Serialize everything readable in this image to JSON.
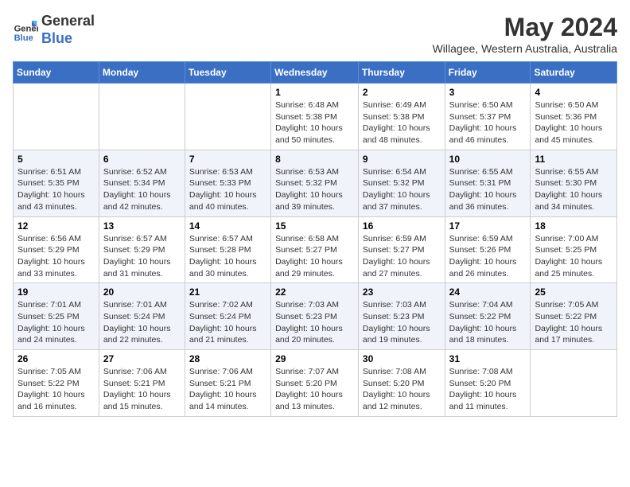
{
  "header": {
    "logo_line1": "General",
    "logo_line2": "Blue",
    "month_year": "May 2024",
    "location": "Willagee, Western Australia, Australia"
  },
  "days_of_week": [
    "Sunday",
    "Monday",
    "Tuesday",
    "Wednesday",
    "Thursday",
    "Friday",
    "Saturday"
  ],
  "weeks": [
    [
      {
        "day": "",
        "info": ""
      },
      {
        "day": "",
        "info": ""
      },
      {
        "day": "",
        "info": ""
      },
      {
        "day": "1",
        "info": "Sunrise: 6:48 AM\nSunset: 5:38 PM\nDaylight: 10 hours\nand 50 minutes."
      },
      {
        "day": "2",
        "info": "Sunrise: 6:49 AM\nSunset: 5:38 PM\nDaylight: 10 hours\nand 48 minutes."
      },
      {
        "day": "3",
        "info": "Sunrise: 6:50 AM\nSunset: 5:37 PM\nDaylight: 10 hours\nand 46 minutes."
      },
      {
        "day": "4",
        "info": "Sunrise: 6:50 AM\nSunset: 5:36 PM\nDaylight: 10 hours\nand 45 minutes."
      }
    ],
    [
      {
        "day": "5",
        "info": "Sunrise: 6:51 AM\nSunset: 5:35 PM\nDaylight: 10 hours\nand 43 minutes."
      },
      {
        "day": "6",
        "info": "Sunrise: 6:52 AM\nSunset: 5:34 PM\nDaylight: 10 hours\nand 42 minutes."
      },
      {
        "day": "7",
        "info": "Sunrise: 6:53 AM\nSunset: 5:33 PM\nDaylight: 10 hours\nand 40 minutes."
      },
      {
        "day": "8",
        "info": "Sunrise: 6:53 AM\nSunset: 5:32 PM\nDaylight: 10 hours\nand 39 minutes."
      },
      {
        "day": "9",
        "info": "Sunrise: 6:54 AM\nSunset: 5:32 PM\nDaylight: 10 hours\nand 37 minutes."
      },
      {
        "day": "10",
        "info": "Sunrise: 6:55 AM\nSunset: 5:31 PM\nDaylight: 10 hours\nand 36 minutes."
      },
      {
        "day": "11",
        "info": "Sunrise: 6:55 AM\nSunset: 5:30 PM\nDaylight: 10 hours\nand 34 minutes."
      }
    ],
    [
      {
        "day": "12",
        "info": "Sunrise: 6:56 AM\nSunset: 5:29 PM\nDaylight: 10 hours\nand 33 minutes."
      },
      {
        "day": "13",
        "info": "Sunrise: 6:57 AM\nSunset: 5:29 PM\nDaylight: 10 hours\nand 31 minutes."
      },
      {
        "day": "14",
        "info": "Sunrise: 6:57 AM\nSunset: 5:28 PM\nDaylight: 10 hours\nand 30 minutes."
      },
      {
        "day": "15",
        "info": "Sunrise: 6:58 AM\nSunset: 5:27 PM\nDaylight: 10 hours\nand 29 minutes."
      },
      {
        "day": "16",
        "info": "Sunrise: 6:59 AM\nSunset: 5:27 PM\nDaylight: 10 hours\nand 27 minutes."
      },
      {
        "day": "17",
        "info": "Sunrise: 6:59 AM\nSunset: 5:26 PM\nDaylight: 10 hours\nand 26 minutes."
      },
      {
        "day": "18",
        "info": "Sunrise: 7:00 AM\nSunset: 5:25 PM\nDaylight: 10 hours\nand 25 minutes."
      }
    ],
    [
      {
        "day": "19",
        "info": "Sunrise: 7:01 AM\nSunset: 5:25 PM\nDaylight: 10 hours\nand 24 minutes."
      },
      {
        "day": "20",
        "info": "Sunrise: 7:01 AM\nSunset: 5:24 PM\nDaylight: 10 hours\nand 22 minutes."
      },
      {
        "day": "21",
        "info": "Sunrise: 7:02 AM\nSunset: 5:24 PM\nDaylight: 10 hours\nand 21 minutes."
      },
      {
        "day": "22",
        "info": "Sunrise: 7:03 AM\nSunset: 5:23 PM\nDaylight: 10 hours\nand 20 minutes."
      },
      {
        "day": "23",
        "info": "Sunrise: 7:03 AM\nSunset: 5:23 PM\nDaylight: 10 hours\nand 19 minutes."
      },
      {
        "day": "24",
        "info": "Sunrise: 7:04 AM\nSunset: 5:22 PM\nDaylight: 10 hours\nand 18 minutes."
      },
      {
        "day": "25",
        "info": "Sunrise: 7:05 AM\nSunset: 5:22 PM\nDaylight: 10 hours\nand 17 minutes."
      }
    ],
    [
      {
        "day": "26",
        "info": "Sunrise: 7:05 AM\nSunset: 5:22 PM\nDaylight: 10 hours\nand 16 minutes."
      },
      {
        "day": "27",
        "info": "Sunrise: 7:06 AM\nSunset: 5:21 PM\nDaylight: 10 hours\nand 15 minutes."
      },
      {
        "day": "28",
        "info": "Sunrise: 7:06 AM\nSunset: 5:21 PM\nDaylight: 10 hours\nand 14 minutes."
      },
      {
        "day": "29",
        "info": "Sunrise: 7:07 AM\nSunset: 5:20 PM\nDaylight: 10 hours\nand 13 minutes."
      },
      {
        "day": "30",
        "info": "Sunrise: 7:08 AM\nSunset: 5:20 PM\nDaylight: 10 hours\nand 12 minutes."
      },
      {
        "day": "31",
        "info": "Sunrise: 7:08 AM\nSunset: 5:20 PM\nDaylight: 10 hours\nand 11 minutes."
      },
      {
        "day": "",
        "info": ""
      }
    ]
  ]
}
